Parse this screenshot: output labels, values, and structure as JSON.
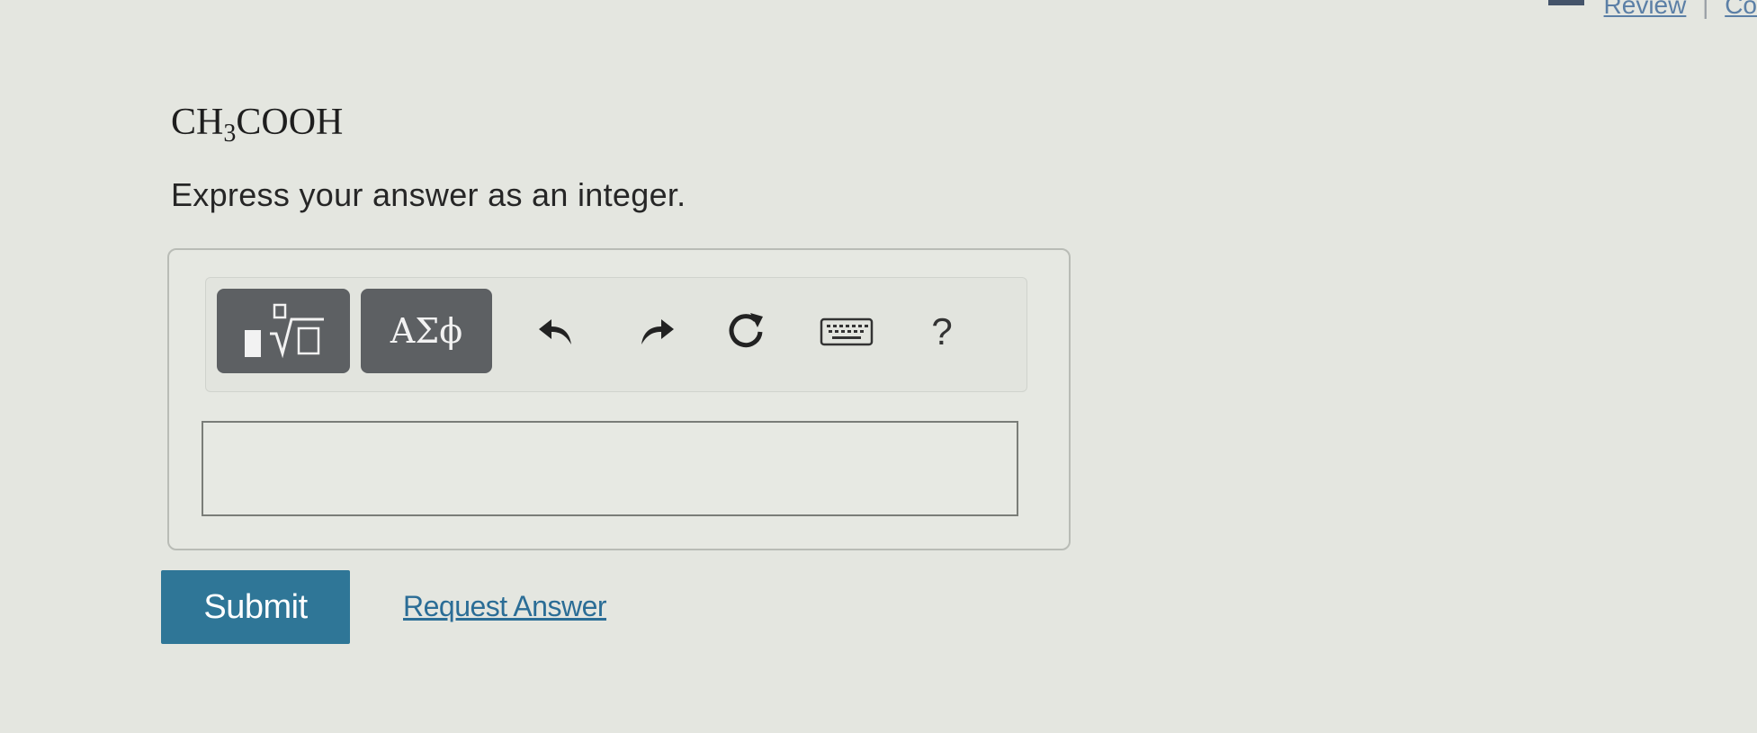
{
  "header": {
    "review_link": "Review",
    "separator": "|",
    "constants_link": "Co"
  },
  "question": {
    "formula_main": "CH",
    "formula_subscript": "3",
    "formula_rest": "COOH",
    "instruction": "Express your answer as an integer."
  },
  "toolbar": {
    "templates_icon": "templates-radical-icon",
    "greek_label": "ΑΣϕ",
    "undo_icon": "undo-icon",
    "redo_icon": "redo-icon",
    "reset_icon": "reset-icon",
    "keyboard_icon": "keyboard-icon",
    "help_label": "?"
  },
  "answer": {
    "value": ""
  },
  "actions": {
    "submit_label": "Submit",
    "request_answer_label": "Request Answer"
  },
  "colors": {
    "background": "#e4e6e0",
    "submit": "#2f7697",
    "link": "#2b6d96",
    "toolbar_button": "#5d6063"
  }
}
